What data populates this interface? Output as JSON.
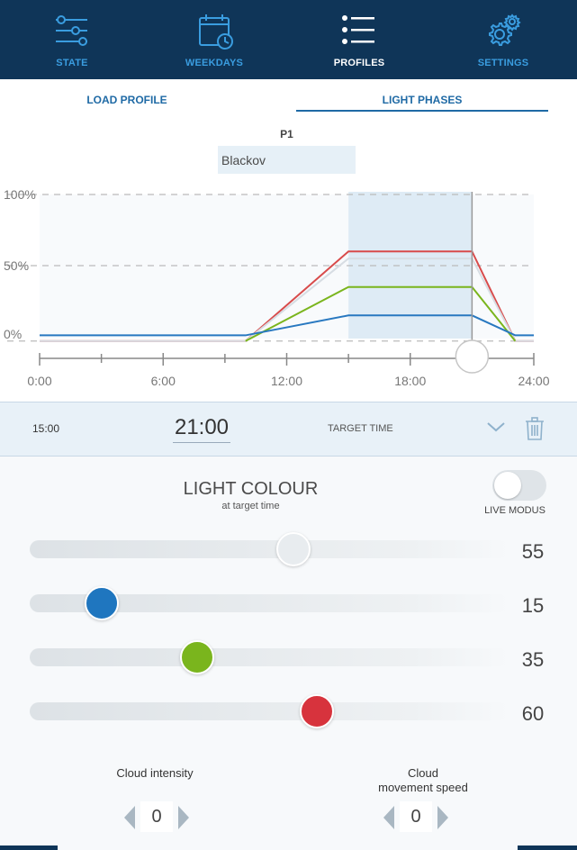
{
  "nav": {
    "items": [
      {
        "label": "STATE",
        "icon": "sliders-icon"
      },
      {
        "label": "WEEKDAYS",
        "icon": "calendar-clock-icon"
      },
      {
        "label": "PROFILES",
        "icon": "list-icon",
        "active": true
      },
      {
        "label": "SETTINGS",
        "icon": "gear-icon"
      }
    ]
  },
  "subtabs": [
    {
      "label": "LOAD PROFILE"
    },
    {
      "label": "LIGHT PHASES",
      "active": true
    }
  ],
  "profile": {
    "id": "P1",
    "name": "Blackov"
  },
  "chart_data": {
    "type": "line",
    "y_tick_labels": [
      "100%",
      "50%",
      "0%"
    ],
    "x_tick_labels": [
      "0:00",
      "6:00",
      "12:00",
      "18:00",
      "24:00"
    ],
    "xlim": [
      0,
      24
    ],
    "ylim": [
      0,
      100
    ],
    "highlight_range": [
      15,
      21
    ],
    "cursor_time": 21,
    "series": [
      {
        "color": "#d84b4b",
        "points": [
          [
            0,
            -3
          ],
          [
            10,
            -3
          ],
          [
            15,
            60
          ],
          [
            21,
            60
          ],
          [
            23.1,
            -3
          ],
          [
            24,
            -3
          ]
        ]
      },
      {
        "color": "#d7dde3",
        "points": [
          [
            0,
            -3
          ],
          [
            10,
            -3
          ],
          [
            15,
            55
          ],
          [
            21,
            55
          ],
          [
            23.1,
            -3
          ],
          [
            24,
            -3
          ]
        ]
      },
      {
        "color": "#7ab51d",
        "points": [
          [
            10,
            -3
          ],
          [
            15,
            35
          ],
          [
            21,
            35
          ],
          [
            23.1,
            -3
          ]
        ]
      },
      {
        "color": "#2878c0",
        "points": [
          [
            0,
            1
          ],
          [
            10,
            1
          ],
          [
            15,
            15
          ],
          [
            21,
            15
          ],
          [
            23.1,
            1
          ],
          [
            24,
            1
          ]
        ]
      }
    ]
  },
  "timebar": {
    "start_time": "15:00",
    "target_time": "21:00",
    "target_label": "TARGET TIME"
  },
  "light": {
    "title": "LIGHT COLOUR",
    "subtitle": "at target time",
    "live_label": "LIVE MODUS",
    "live_on": false,
    "sliders": [
      {
        "value": "55",
        "level": 55,
        "color": "#e8ecef"
      },
      {
        "value": "15",
        "level": 15,
        "color": "#1f76bf"
      },
      {
        "value": "35",
        "level": 35,
        "color": "#7ab51d"
      },
      {
        "value": "60",
        "level": 60,
        "color": "#d7333d"
      }
    ]
  },
  "clouds": {
    "intensity_label": "Cloud intensity",
    "intensity_value": "0",
    "speed_label_line1": "Cloud",
    "speed_label_line2": "movement speed",
    "speed_value": "0"
  },
  "colors": {
    "nav_bg": "#0f3558",
    "accent": "#1f6aa5",
    "nav_inactive": "#3a9de0"
  }
}
